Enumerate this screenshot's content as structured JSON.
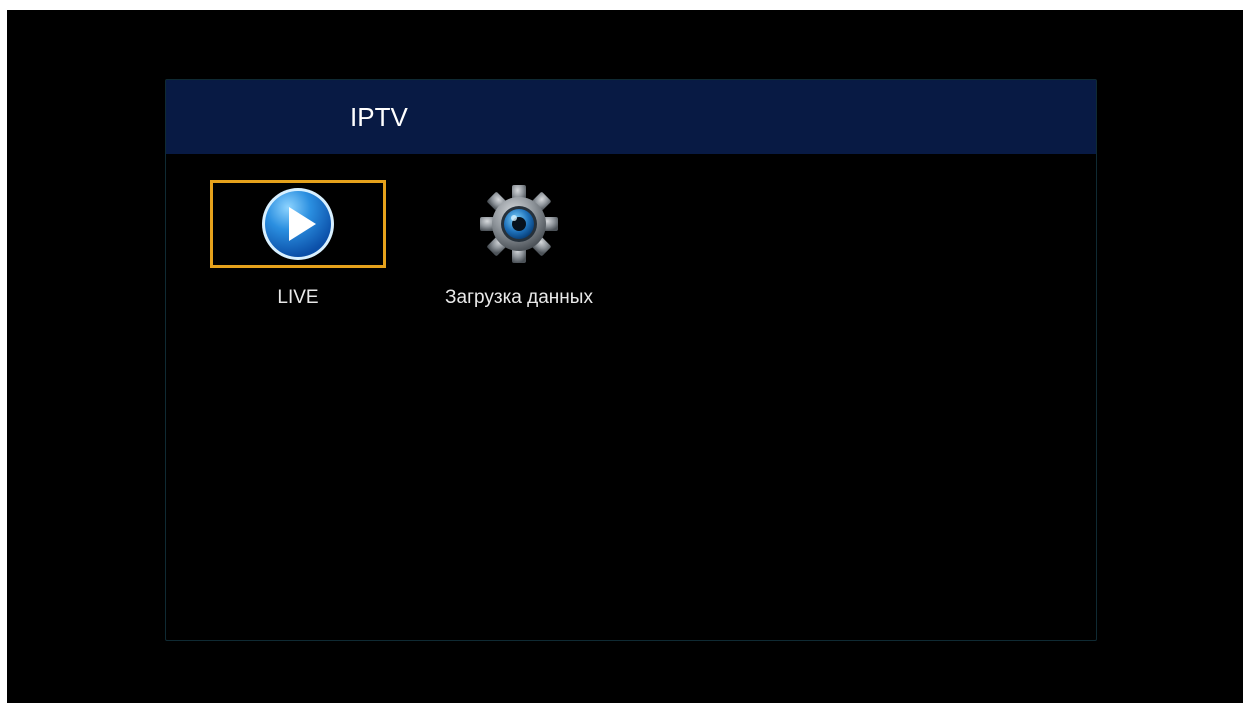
{
  "header": {
    "title": "IPTV"
  },
  "menu": {
    "items": [
      {
        "label": "LIVE",
        "icon": "play-icon",
        "selected": true
      },
      {
        "label": "Загрузка данных",
        "icon": "gear-icon",
        "selected": false
      }
    ]
  },
  "colors": {
    "header_background": "#081a44",
    "selection_border": "#e6a21c",
    "screen_background": "#000000",
    "text": "#e9e9e9"
  }
}
